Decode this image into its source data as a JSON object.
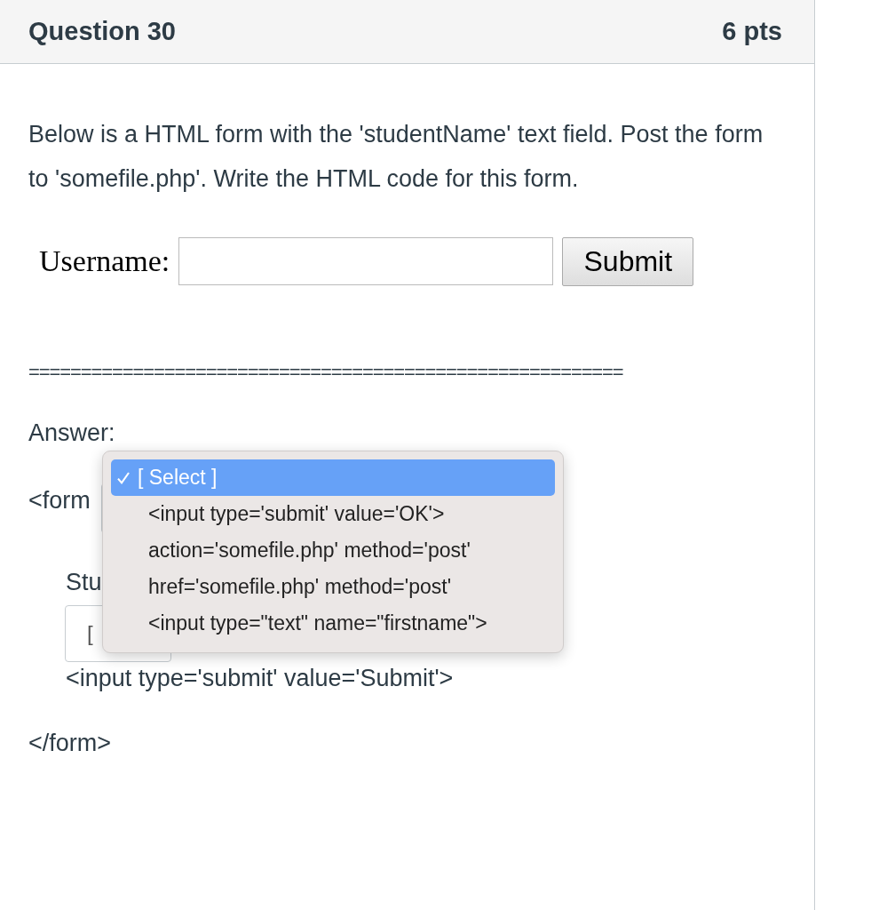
{
  "header": {
    "title": "Question 30",
    "points": "6 pts"
  },
  "question": {
    "text": "Below is a HTML form with the 'studentName' text field. Post the form to 'somefile.php'. Write the HTML code for this form."
  },
  "sample_form": {
    "label": "Username:",
    "button": "Submit"
  },
  "separator": "=========================================================",
  "answer_label": "Answer:",
  "answer_lines": [
    {
      "kind": "dropdown_line",
      "text": "<form"
    },
    {
      "kind": "text",
      "text": "Stu"
    },
    {
      "kind": "select",
      "text": "[ "
    },
    {
      "kind": "text",
      "text": "<input type='submit' value='Submit'>"
    },
    {
      "kind": "text",
      "text": "</form>"
    }
  ],
  "dropdown_menu": {
    "options": [
      {
        "label": "[ Select ]",
        "selected": true
      },
      {
        "label": "<input type='submit' value='OK'>",
        "selected": false
      },
      {
        "label": "action='somefile.php' method='post'",
        "selected": false
      },
      {
        "label": "href='somefile.php' method='post'",
        "selected": false
      },
      {
        "label": "<input type=\"text\" name=\"firstname\">",
        "selected": false
      }
    ]
  }
}
